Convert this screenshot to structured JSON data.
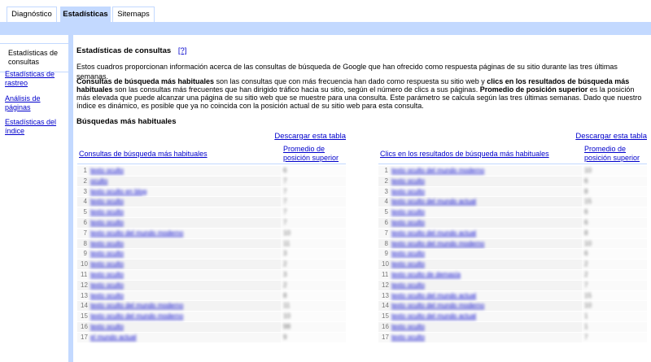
{
  "tabs": [
    {
      "label": "Diagnóstico",
      "active": false
    },
    {
      "label": "Estadísticas",
      "active": true
    },
    {
      "label": "Sitemaps",
      "active": false
    }
  ],
  "sidebar": {
    "items": [
      {
        "label": "Estadísticas de consultas",
        "active": true
      },
      {
        "label": "Estadísticas de rastreo",
        "active": false
      },
      {
        "label": "Análisis de páginas",
        "active": false
      },
      {
        "label": "Estadísticas del índice",
        "active": false
      }
    ]
  },
  "main": {
    "title": "Estadísticas de consultas",
    "help_link": "[?]",
    "intro": "Estos cuadros proporcionan información acerca de las consultas de búsqueda de Google que han ofrecido como respuesta páginas de su sitio durante las tres últimas semanas.",
    "desc": {
      "b1": "Consultas de búsqueda más habituales",
      "t1": " son las consultas que con más frecuencia han dado como respuesta su sitio web y ",
      "b2": "clics en los resultados de búsqueda más habituales",
      "t2": " son las consultas más frecuentes que han dirigido tráfico hacia su sitio, según el número de clics a sus páginas. ",
      "b3": "Promedio de posición superior",
      "t3": " es la posición más elevada que puede alcanzar una página de su sitio web que se muestre para una consulta. Este parámetro se calcula según las tres últimas semanas. Dado que nuestro índice es dinámico, es posible que ya no coincida con la posición actual de su sitio web para esta consulta."
    },
    "subtitle": "Búsquedas más habituales"
  },
  "table_left": {
    "download": "Descargar esta tabla",
    "col1": "Consultas de búsqueda más habituales",
    "col2": "Promedio de posición superior",
    "rows": [
      {
        "n": "1",
        "q": "texto oculto",
        "p": "6"
      },
      {
        "n": "2",
        "q": "oculto",
        "p": "7"
      },
      {
        "n": "3",
        "q": "texto oculto en blog",
        "p": "7"
      },
      {
        "n": "4",
        "q": "texto oculto",
        "p": "7"
      },
      {
        "n": "5",
        "q": "texto oculto",
        "p": "7"
      },
      {
        "n": "6",
        "q": "texto oculto",
        "p": "7"
      },
      {
        "n": "7",
        "q": "texto oculto del mundo moderno",
        "p": "10"
      },
      {
        "n": "8",
        "q": "texto oculto",
        "p": "11"
      },
      {
        "n": "9",
        "q": "texto oculto",
        "p": "3"
      },
      {
        "n": "10",
        "q": "texto oculto",
        "p": "2"
      },
      {
        "n": "11",
        "q": "texto oculto",
        "p": "3"
      },
      {
        "n": "12",
        "q": "texto oculto",
        "p": "2"
      },
      {
        "n": "13",
        "q": "texto oculto",
        "p": "8"
      },
      {
        "n": "14",
        "q": "texto oculto del mundo moderno",
        "p": "11"
      },
      {
        "n": "15",
        "q": "texto oculto del mundo moderno",
        "p": "10"
      },
      {
        "n": "16",
        "q": "texto oculto",
        "p": "98"
      },
      {
        "n": "17",
        "q": "el mundo actual",
        "p": "9"
      }
    ]
  },
  "table_right": {
    "download": "Descargar esta tabla",
    "col1": "Clics en los resultados de búsqueda más habituales",
    "col2": "Promedio de posición superior",
    "rows": [
      {
        "n": "1",
        "q": "texto oculto del mundo moderno",
        "p": "10"
      },
      {
        "n": "2",
        "q": "texto oculto",
        "p": "6"
      },
      {
        "n": "3",
        "q": "texto oculto",
        "p": "8"
      },
      {
        "n": "4",
        "q": "texto oculto del mundo actual",
        "p": "15"
      },
      {
        "n": "5",
        "q": "texto oculto",
        "p": "6"
      },
      {
        "n": "6",
        "q": "texto oculto",
        "p": "6"
      },
      {
        "n": "7",
        "q": "texto oculto del mundo actual",
        "p": "8"
      },
      {
        "n": "8",
        "q": "texto oculto del mundo moderno",
        "p": "10"
      },
      {
        "n": "9",
        "q": "texto oculto",
        "p": "6"
      },
      {
        "n": "10",
        "q": "texto oculto",
        "p": "2"
      },
      {
        "n": "11",
        "q": "texto oculto de demasía",
        "p": "2"
      },
      {
        "n": "12",
        "q": "texto oculto",
        "p": "7"
      },
      {
        "n": "13",
        "q": "texto oculto del mundo actual",
        "p": "15"
      },
      {
        "n": "14",
        "q": "texto oculto del mundo moderno",
        "p": "10"
      },
      {
        "n": "15",
        "q": "texto oculto del mundo actual",
        "p": "1"
      },
      {
        "n": "16",
        "q": "texto oculto",
        "p": "1"
      },
      {
        "n": "17",
        "q": "texto oculto",
        "p": "7"
      }
    ]
  }
}
